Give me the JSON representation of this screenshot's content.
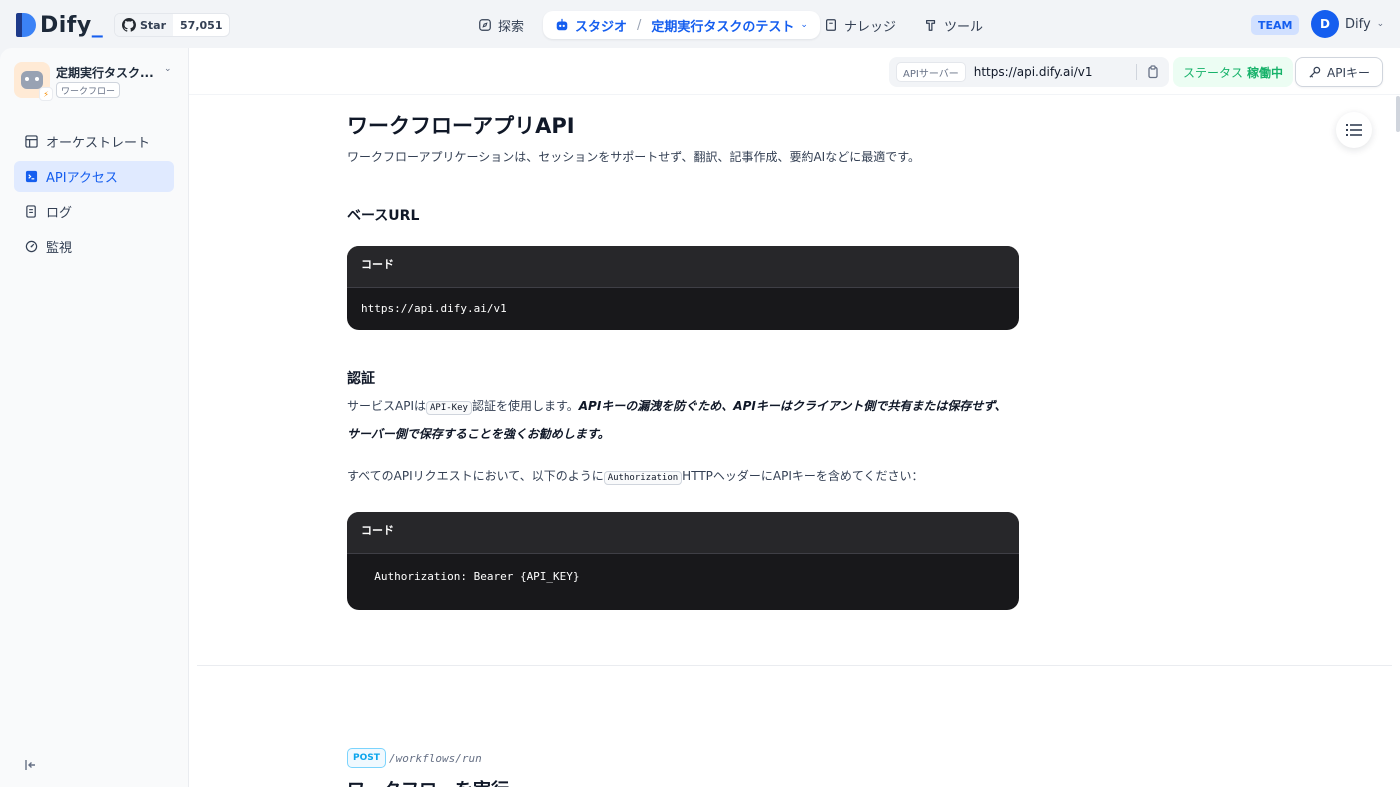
{
  "brand": {
    "name": "Dify",
    "accent": "#155eef"
  },
  "github": {
    "star_label": "Star",
    "star_count": "57,051"
  },
  "nav": {
    "explore": "探索",
    "studio": "スタジオ",
    "current_app": "定期実行タスクのテスト",
    "knowledge": "ナレッジ",
    "tools": "ツール"
  },
  "account": {
    "team_badge": "TEAM",
    "avatar_initial": "D",
    "name": "Dify"
  },
  "sidebar": {
    "app_name": "定期実行タスク...",
    "app_type": "ワークフロー",
    "items": [
      {
        "label": "オーケストレート",
        "icon": "layout-icon"
      },
      {
        "label": "APIアクセス",
        "icon": "terminal-icon"
      },
      {
        "label": "ログ",
        "icon": "file-list-icon"
      },
      {
        "label": "監視",
        "icon": "dashboard-icon"
      }
    ]
  },
  "toolbar": {
    "api_server_label": "APIサーバー",
    "api_server_url": "https://api.dify.ai/v1",
    "status_label": "ステータス",
    "status_value": "稼働中",
    "api_key_button": "APIキー"
  },
  "doc": {
    "title": "ワークフローアプリAPI",
    "lead": "ワークフローアプリケーションは、セッションをサポートせず、翻訳、記事作成、要約AIなどに最適です。",
    "base_url_heading": "ベースURL",
    "code_label": "コード",
    "base_url_code": "https://api.dify.ai/v1",
    "auth_heading": "認証",
    "auth_p1_prefix": "サービスAPIは",
    "auth_p1_code": "API-Key",
    "auth_p1_suffix": "認証を使用します。",
    "auth_p1_emphasis_1": "APIキーの漏洩を防ぐため、APIキーはクライアント側で共有または保存せず、",
    "auth_p1_emphasis_2": "サーバー側で保存することを強くお勧めします。",
    "auth_p2_prefix": "すべてのAPIリクエストにおいて、以下のように",
    "auth_p2_code": "Authorization",
    "auth_p2_suffix": "HTTPヘッダーにAPIキーを含めてください：",
    "auth_code": "  Authorization: Bearer {API_KEY}",
    "endpoint_method": "POST",
    "endpoint_path": "/workflows/run",
    "run_heading": "ワークフローを実行"
  }
}
